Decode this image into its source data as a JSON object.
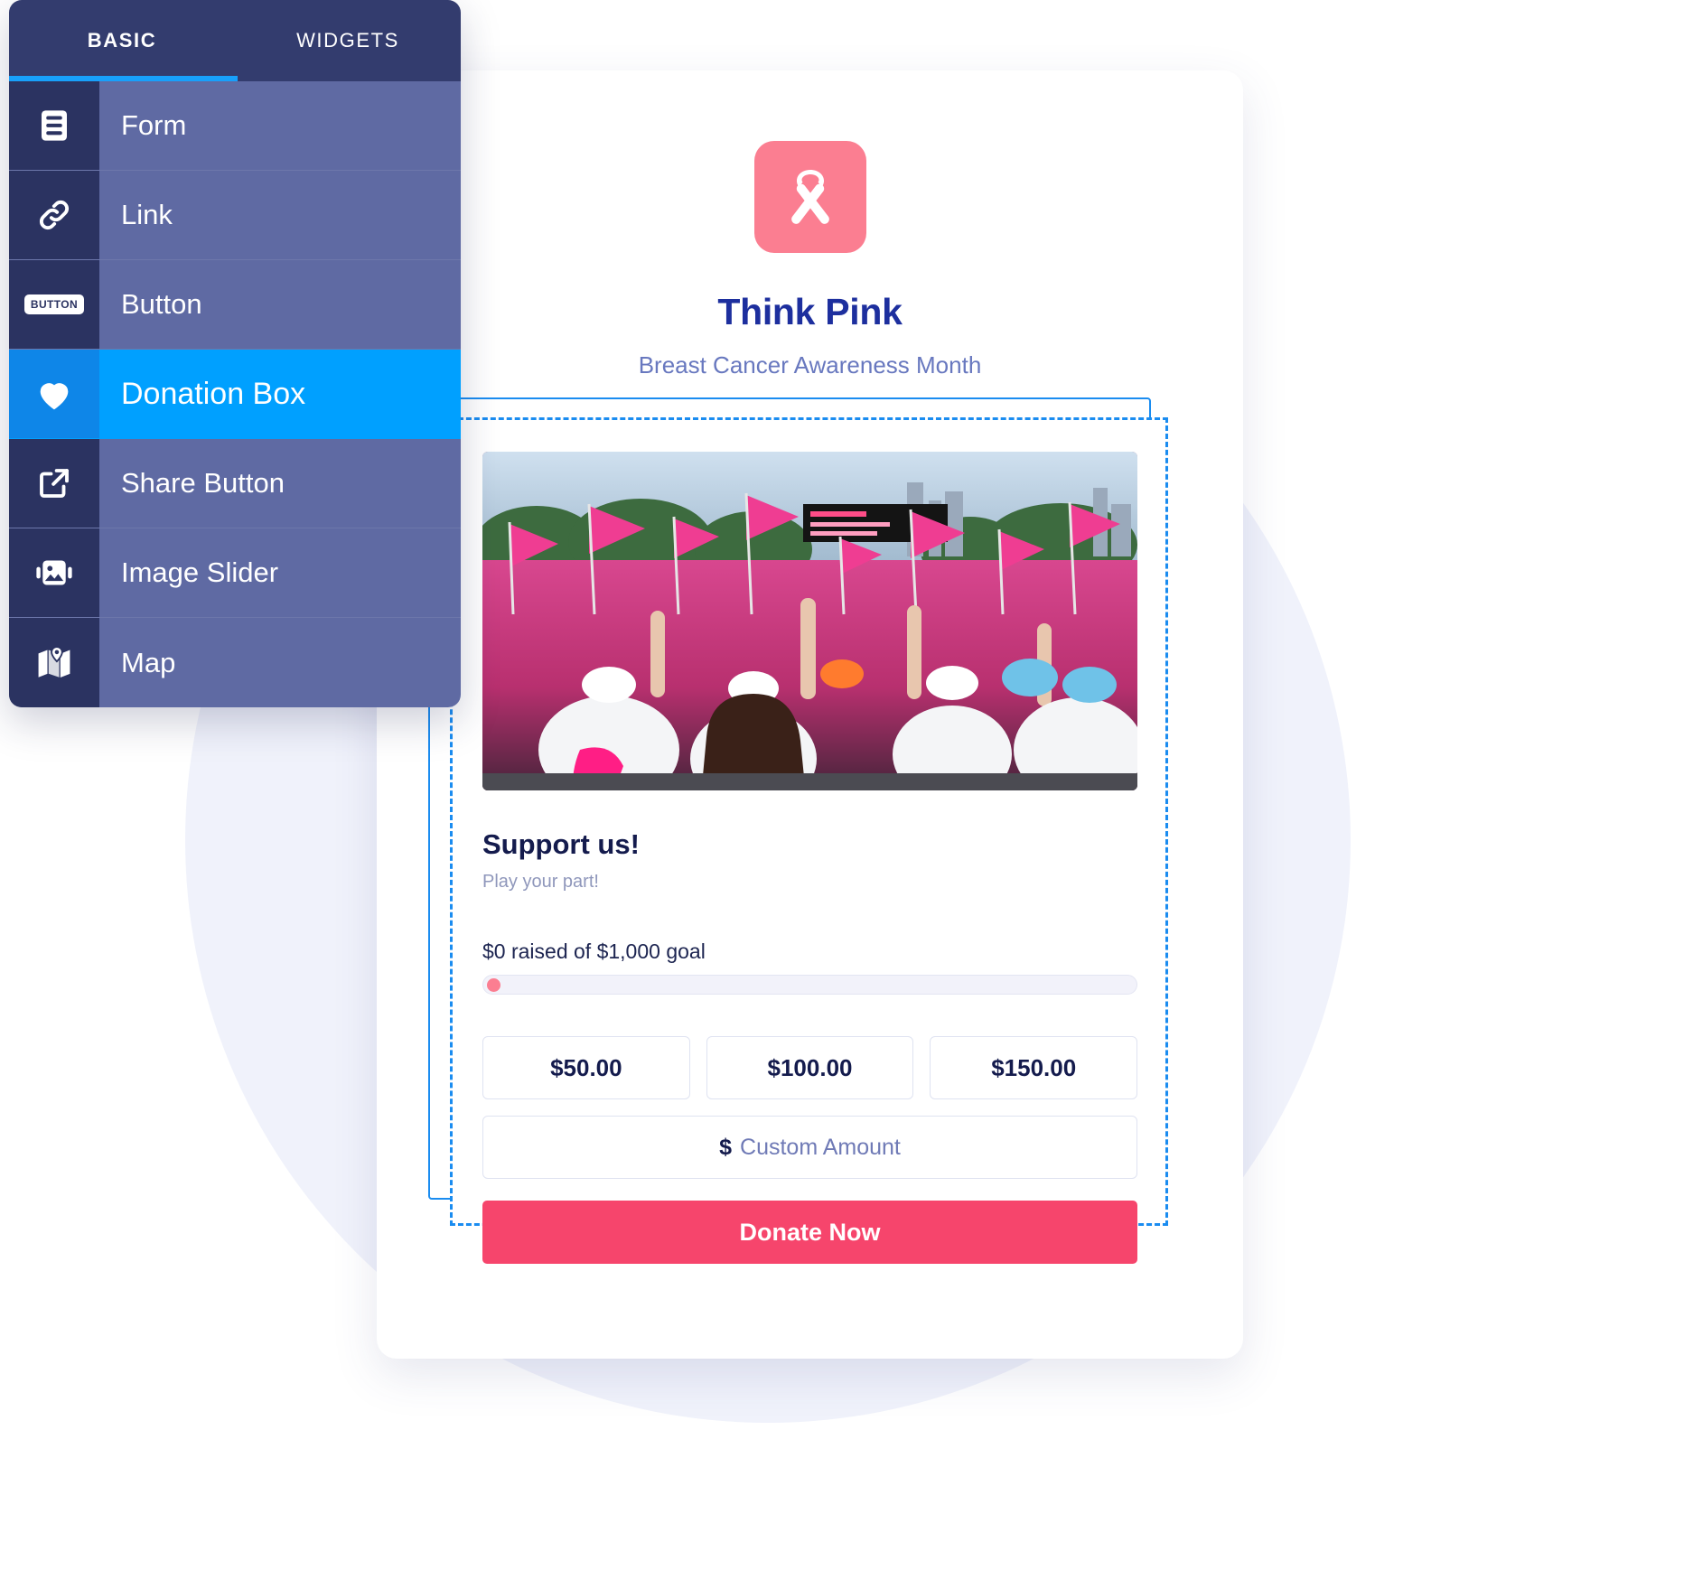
{
  "panel": {
    "tabs": [
      {
        "label": "BASIC",
        "active": true
      },
      {
        "label": "WIDGETS",
        "active": false
      }
    ],
    "items": [
      {
        "label": "Form",
        "icon": "form-icon",
        "selected": false
      },
      {
        "label": "Link",
        "icon": "link-icon",
        "selected": false
      },
      {
        "label": "Button",
        "icon": "button-icon",
        "selected": false
      },
      {
        "label": "Donation Box",
        "icon": "heart-icon",
        "selected": true
      },
      {
        "label": "Share Button",
        "icon": "share-icon",
        "selected": false
      },
      {
        "label": "Image Slider",
        "icon": "image-slider-icon",
        "selected": false
      },
      {
        "label": "Map",
        "icon": "map-icon",
        "selected": false
      }
    ]
  },
  "brand": {
    "logo_icon": "awareness-ribbon-icon",
    "title": "Think Pink",
    "subtitle": "Breast Cancer Awareness Month"
  },
  "donation": {
    "hero_alt": "crowd-with-pink-flags-photo",
    "title": "Support us!",
    "subtitle": "Play your part!",
    "raised_text": "$0 raised of $1,000 goal",
    "raised_amount": "$0",
    "goal_amount": "$1,000",
    "progress_percent": 0,
    "amounts": [
      "$50.00",
      "$100.00",
      "$150.00"
    ],
    "custom_currency": "$",
    "custom_placeholder": "Custom Amount",
    "donate_label": "Donate Now"
  },
  "colors": {
    "accent_blue": "#00a0ff",
    "tab_underline": "#18a0fb",
    "panel_dark": "#2b3361",
    "panel_mid": "#5f6aa3",
    "panel_header": "#333c6e",
    "brand_pink": "#fb7e91",
    "donate_pink": "#f6456c",
    "title_navy": "#1d2f9e",
    "subtitle_blue": "#6878bf"
  }
}
